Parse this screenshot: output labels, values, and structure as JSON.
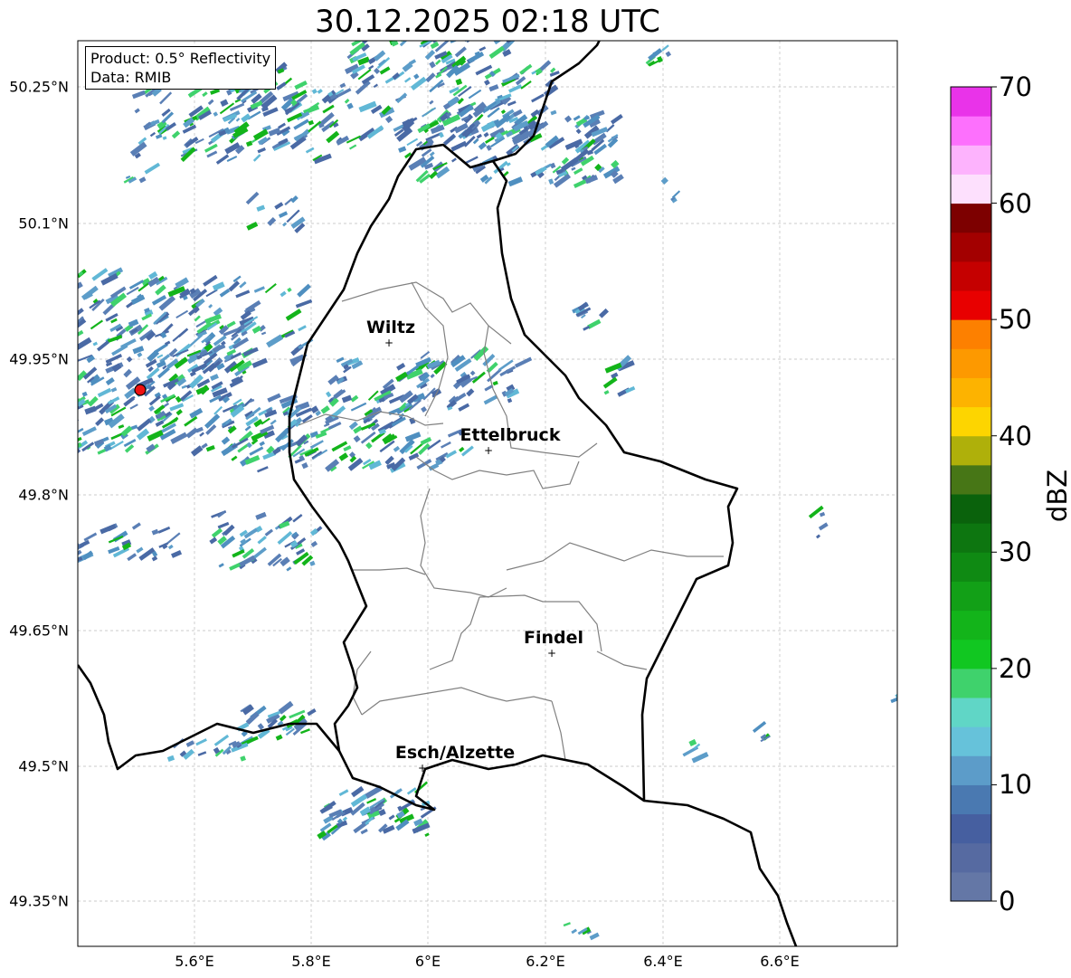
{
  "title": "30.12.2025 02:18 UTC",
  "info": {
    "product": "Product: 0.5° Reflectivity",
    "data": "Data: RMIB"
  },
  "lat_ticks": [
    "50.25°N",
    "50.1°N",
    "49.95°N",
    "49.8°N",
    "49.65°N",
    "49.5°N",
    "49.35°N"
  ],
  "lon_ticks": [
    "5.6°E",
    "5.8°E",
    "6°E",
    "6.2°E",
    "6.4°E",
    "6.6°E"
  ],
  "cities": [
    {
      "name": "Wiltz"
    },
    {
      "name": "Ettelbruck"
    },
    {
      "name": "Findel"
    },
    {
      "name": "Esch/Alzette"
    }
  ],
  "colorbar": {
    "label": "dBZ",
    "ticks": [
      "0",
      "10",
      "20",
      "30",
      "40",
      "50",
      "60",
      "70"
    ],
    "colors": [
      "#6477a6",
      "#566aa1",
      "#465fa0",
      "#4a79b1",
      "#5c9cc9",
      "#66c2da",
      "#60d6c6",
      "#3fd26c",
      "#11c721",
      "#13b41a",
      "#12a017",
      "#0f8a13",
      "#0d7610",
      "#0a620c",
      "#477616",
      "#afb00a",
      "#fdd500",
      "#fdb300",
      "#fd9900",
      "#fd8000",
      "#e80000",
      "#c50000",
      "#a30000",
      "#7d0000",
      "#fde0fd",
      "#fdb3fd",
      "#fd70fd",
      "#e933e9"
    ]
  },
  "colors": {
    "border": "#000000",
    "canton_line": "#808080",
    "grid": "#bbbbbb",
    "radar_site": "#ee1111"
  }
}
